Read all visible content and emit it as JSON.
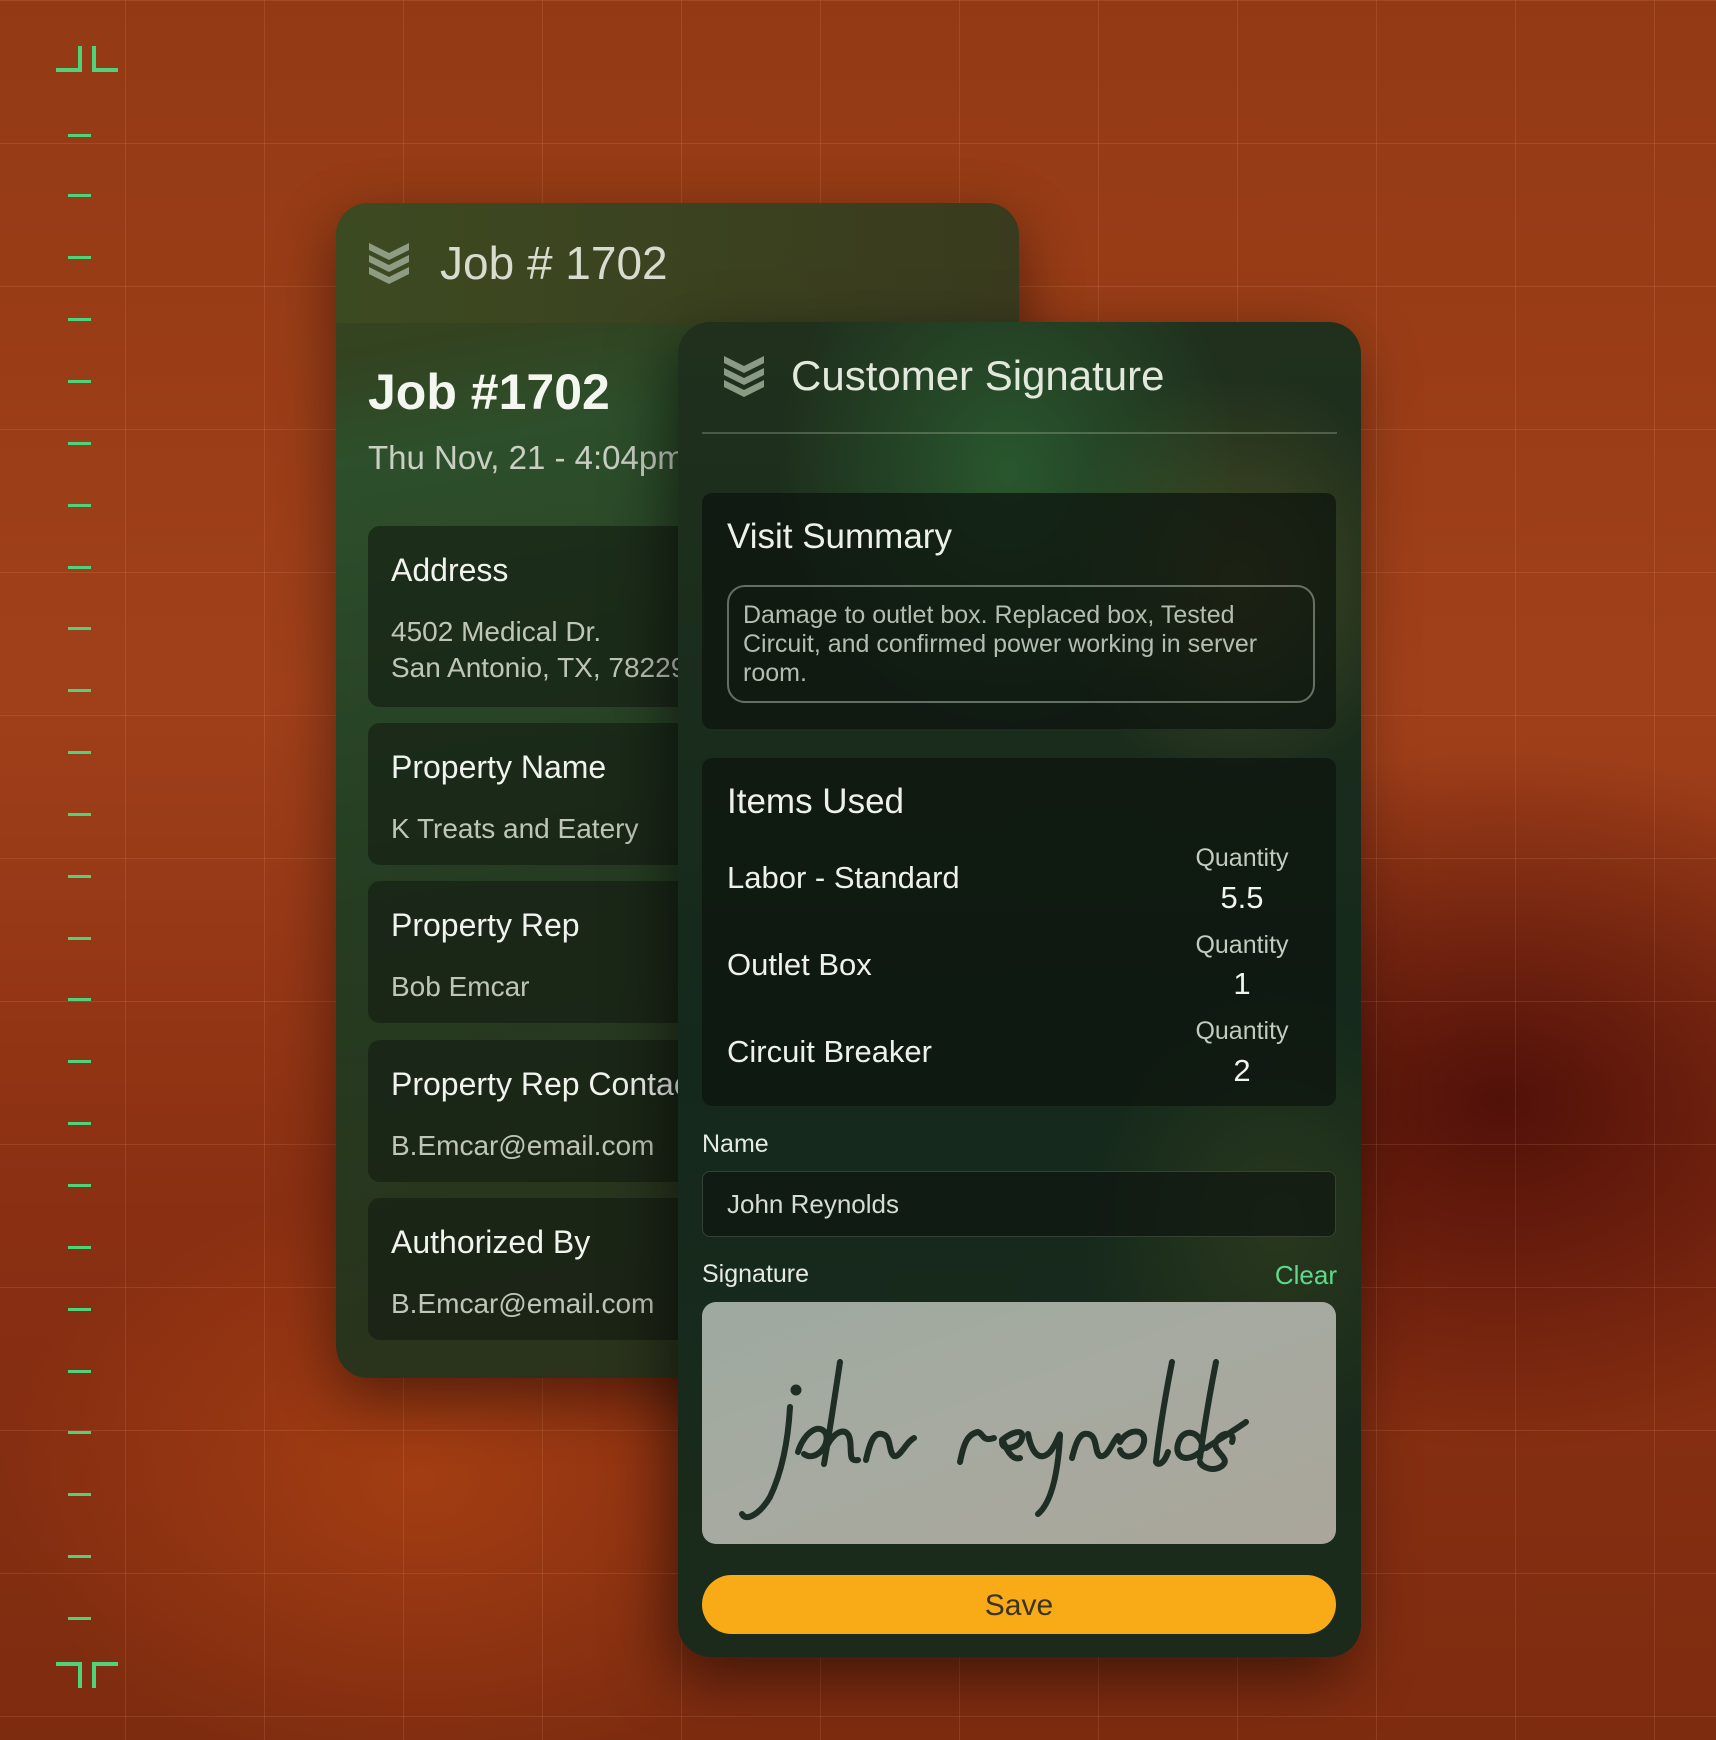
{
  "background": {
    "accent_color": "#4ed37a",
    "base_color": "#933a14"
  },
  "job_card": {
    "top_title": "Job # 1702",
    "title": "Job #1702",
    "date": "Thu Nov, 21 - 4:04pm",
    "sections": [
      {
        "label": "Address",
        "value_lines": [
          "4502 Medical Dr.",
          "San Antonio, TX, 78229"
        ]
      },
      {
        "label": "Property Name",
        "value_lines": [
          "K Treats and Eatery"
        ]
      },
      {
        "label": "Property Rep",
        "value_lines": [
          "Bob Emcar"
        ]
      },
      {
        "label": "Property Rep Contact",
        "value_lines": [
          "B.Emcar@email.com"
        ]
      },
      {
        "label": "Authorized By",
        "value_lines": [
          "B.Emcar@email.com"
        ]
      }
    ]
  },
  "signature_card": {
    "title": "Customer Signature",
    "visit_summary": {
      "title": "Visit Summary",
      "text": "Damage to outlet box. Replaced box, Tested Circuit, and confirmed power working in server room."
    },
    "items_used": {
      "title": "Items Used",
      "quantity_label": "Quantity",
      "items": [
        {
          "name": "Labor - Standard",
          "quantity": "5.5"
        },
        {
          "name": "Outlet Box",
          "quantity": "1"
        },
        {
          "name": "Circuit Breaker",
          "quantity": "2"
        }
      ]
    },
    "name_field": {
      "label": "Name",
      "value": "John Reynolds"
    },
    "signature": {
      "label": "Signature",
      "clear_label": "Clear",
      "handwriting": "john reynolds"
    },
    "save_label": "Save",
    "save_color": "#f8ab16"
  }
}
